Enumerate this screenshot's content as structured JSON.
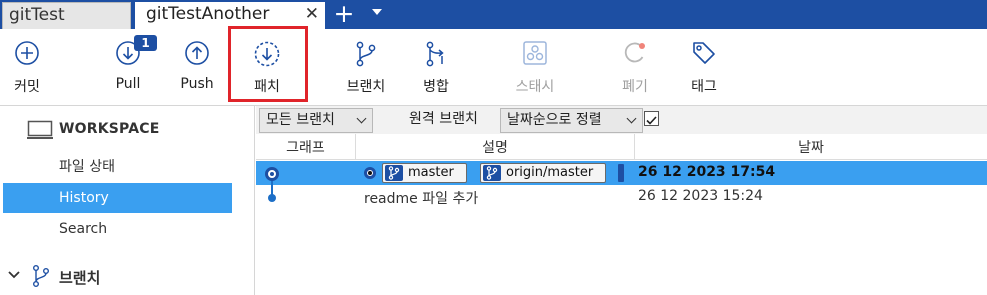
{
  "tabs": [
    {
      "label": "gitTest",
      "active": false
    },
    {
      "label": "gitTestAnother",
      "active": true
    }
  ],
  "tab_close_symbol": "✕",
  "tab_add_symbol": "+",
  "toolbar": {
    "commit_label": "커밋",
    "pull_label": "Pull",
    "pull_badge": "1",
    "push_label": "Push",
    "fetch_label": "패치",
    "branch_label": "브랜치",
    "merge_label": "병합",
    "stash_label": "스태시",
    "discard_label": "폐기",
    "tag_label": "태그"
  },
  "sidebar": {
    "workspace_label": "WORKSPACE",
    "items": [
      {
        "label": "파일 상태",
        "selected": false
      },
      {
        "label": "History",
        "selected": true
      },
      {
        "label": "Search",
        "selected": false
      }
    ],
    "branches_label": "브랜치"
  },
  "filters": {
    "branch_filter": "모든 브랜치",
    "remote_branch_label": "원격 브랜치",
    "remote_branch_checked": true,
    "sort_label": "날짜순으로 정렬"
  },
  "columns": {
    "graph": "그래프",
    "description": "설명",
    "date": "날짜"
  },
  "commits": [
    {
      "refs": [
        "master",
        "origin/master"
      ],
      "description": "",
      "date": "26 12 2023 17:54",
      "selected": true
    },
    {
      "refs": [],
      "description": "readme 파일 추가",
      "date": "26 12 2023 15:24",
      "selected": false
    }
  ],
  "colors": {
    "accent": "#1d4fa3",
    "selection": "#3a9ff0",
    "highlight_box": "#e0242a"
  }
}
